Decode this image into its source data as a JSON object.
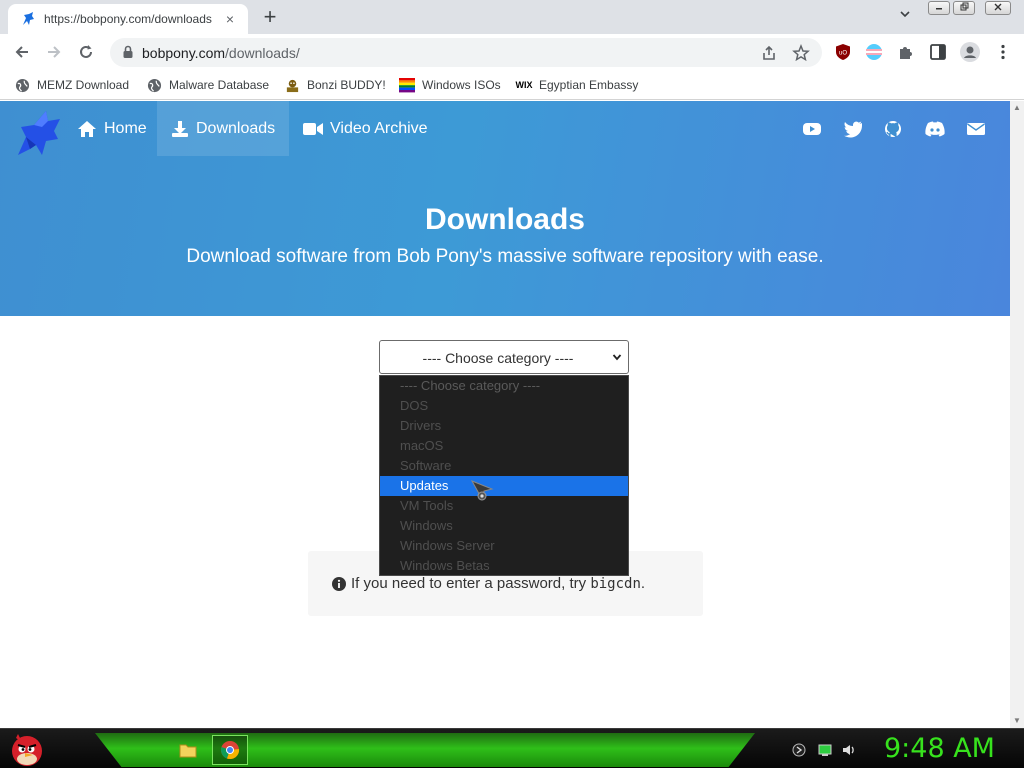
{
  "browser": {
    "tab_title": "https://bobpony.com/downloads",
    "tab_close": "×",
    "new_tab": "+",
    "url_host": "bobpony.com",
    "url_path": "/downloads/",
    "window_controls": [
      "minimize",
      "restore",
      "close"
    ]
  },
  "bookmarks": [
    {
      "label": "MEMZ Download",
      "icon": "globe-icon"
    },
    {
      "label": "Malware Database",
      "icon": "globe-icon"
    },
    {
      "label": "Bonzi BUDDY!",
      "icon": "bonzi-icon"
    },
    {
      "label": "Windows ISOs",
      "icon": "rainbow-icon"
    },
    {
      "label": "Egyptian Embassy",
      "icon": "wix-icon"
    }
  ],
  "bookmark_wix": "WIX",
  "site": {
    "nav": [
      {
        "label": "Home",
        "icon": "home-icon"
      },
      {
        "label": "Downloads",
        "icon": "download-icon",
        "active": true
      },
      {
        "label": "Video Archive",
        "icon": "video-icon"
      }
    ],
    "social": [
      "youtube-icon",
      "twitter-icon",
      "github-icon",
      "discord-icon",
      "mail-icon"
    ],
    "title": "Downloads",
    "subtitle": "Download software from Bob Pony's massive software repository with ease."
  },
  "category_select": {
    "value": "---- Choose category ----",
    "options": [
      "---- Choose category ----",
      "DOS",
      "Drivers",
      "macOS",
      "Software",
      "Updates",
      "VM Tools",
      "Windows",
      "Windows Server",
      "Windows Betas"
    ],
    "highlighted": "Updates"
  },
  "note": {
    "text": "If you need to enter a password, try",
    "code": "bigcdn",
    "end": "."
  },
  "taskbar": {
    "clock": "9:48 AM"
  },
  "colors": {
    "hero_start": "#3f8fd1",
    "hero_end": "#4a86dc",
    "option_highlight": "#1a73e8",
    "clock": "#37e21d"
  }
}
